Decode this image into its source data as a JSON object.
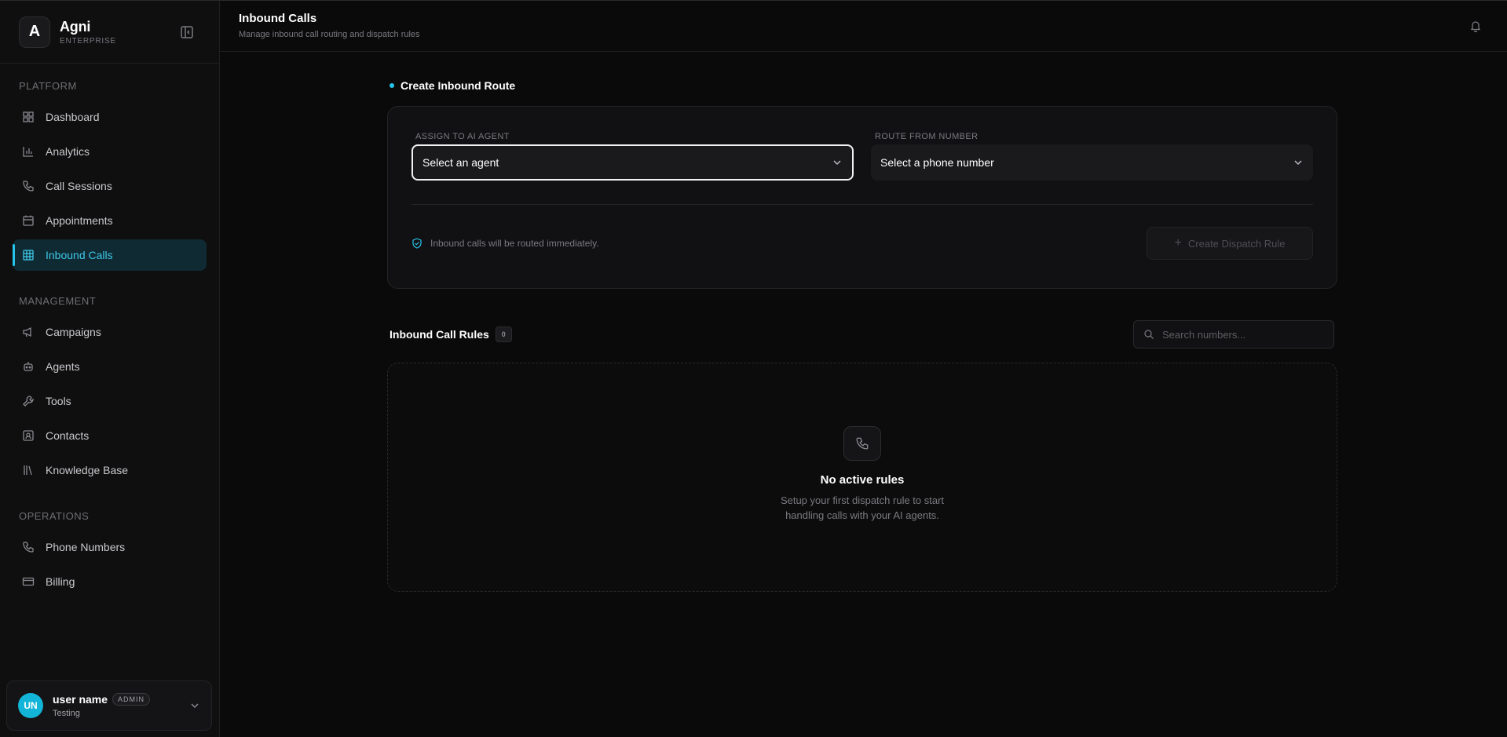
{
  "brand": {
    "initial": "A",
    "name": "Agni",
    "tier": "ENTERPRISE"
  },
  "nav": {
    "platform_heading": "PLATFORM",
    "platform": [
      {
        "label": "Dashboard",
        "icon": "dashboard-icon"
      },
      {
        "label": "Analytics",
        "icon": "bar-chart-icon"
      },
      {
        "label": "Call Sessions",
        "icon": "phone-icon"
      },
      {
        "label": "Appointments",
        "icon": "calendar-icon"
      },
      {
        "label": "Inbound Calls",
        "icon": "grid-icon",
        "active": true
      }
    ],
    "management_heading": "MANAGEMENT",
    "management": [
      {
        "label": "Campaigns",
        "icon": "megaphone-icon"
      },
      {
        "label": "Agents",
        "icon": "bot-icon"
      },
      {
        "label": "Tools",
        "icon": "wrench-icon"
      },
      {
        "label": "Contacts",
        "icon": "contact-icon"
      },
      {
        "label": "Knowledge Base",
        "icon": "library-icon"
      }
    ],
    "operations_heading": "OPERATIONS",
    "operations": [
      {
        "label": "Phone Numbers",
        "icon": "phone-icon"
      },
      {
        "label": "Billing",
        "icon": "credit-card-icon"
      }
    ]
  },
  "user": {
    "initials": "UN",
    "name": "user name",
    "role": "ADMIN",
    "org": "Testing"
  },
  "header": {
    "title": "Inbound Calls",
    "subtitle": "Manage inbound call routing and dispatch rules"
  },
  "create_route": {
    "heading": "Create Inbound Route",
    "agent_label": "ASSIGN TO AI AGENT",
    "agent_value": "Select an agent",
    "number_label": "ROUTE FROM NUMBER",
    "number_value": "Select a phone number",
    "note": "Inbound calls will be routed immediately.",
    "button_label": "Create Dispatch Rule"
  },
  "rules": {
    "title": "Inbound Call Rules",
    "count": "0",
    "search_placeholder": "Search numbers...",
    "empty_title": "No active rules",
    "empty_desc": "Setup your first dispatch rule to start handling calls with your AI agents."
  },
  "colors": {
    "accent": "#27c4ea",
    "background": "#0a0a0b",
    "active_bg": "#0f2a33"
  }
}
